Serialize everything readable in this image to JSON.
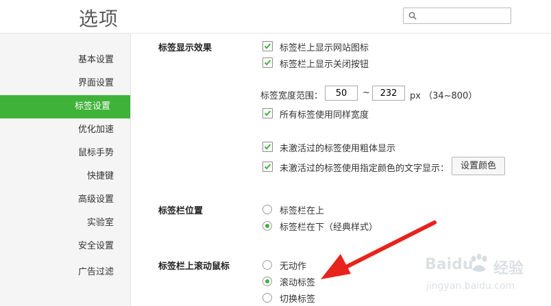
{
  "window": {
    "title": "选项"
  },
  "search": {
    "placeholder": ""
  },
  "sidebar": {
    "items": [
      {
        "label": "基本设置"
      },
      {
        "label": "界面设置"
      },
      {
        "label": "标签设置"
      },
      {
        "label": "优化加速"
      },
      {
        "label": "鼠标手势"
      },
      {
        "label": "快捷键"
      },
      {
        "label": "高级设置"
      },
      {
        "label": "实验室"
      },
      {
        "label": "安全设置"
      },
      {
        "label": "广告过滤"
      }
    ],
    "active_index": 2
  },
  "tab_display": {
    "title": "标签显示效果",
    "show_site_icon": {
      "label": "标签栏上显示网站图标",
      "checked": true
    },
    "show_close_btn": {
      "label": "标签栏上显示关闭按钮",
      "checked": true
    },
    "width_range": {
      "label": "标签宽度范围：",
      "min": "50",
      "separator": "~",
      "max": "232",
      "unit": "px （34~800）"
    },
    "same_width": {
      "label": "所有标签使用同样宽度",
      "checked": true
    },
    "bold_inactive": {
      "label": "未激活过的标签使用粗体显示",
      "checked": true
    },
    "color_inactive": {
      "label": "未激活过的标签使用指定颜色的文字显示：",
      "checked": true
    },
    "set_color_button": "设置颜色"
  },
  "tab_position": {
    "title": "标签栏位置",
    "options": [
      {
        "label": "标签栏在上",
        "selected": false
      },
      {
        "label": "标签栏在下（经典样式）",
        "selected": true
      }
    ]
  },
  "scroll_wheel": {
    "title": "标签栏上滚动鼠标",
    "options": [
      {
        "label": "无动作",
        "selected": false
      },
      {
        "label": "滚动标签",
        "selected": true
      },
      {
        "label": "切换标签",
        "selected": false
      }
    ]
  },
  "watermark": {
    "brand": "Baidu",
    "brand_cn": "经验",
    "url": "jingyan.baidu.com"
  },
  "colors": {
    "accent": "#3fb239",
    "arrow": "#e8231c"
  }
}
